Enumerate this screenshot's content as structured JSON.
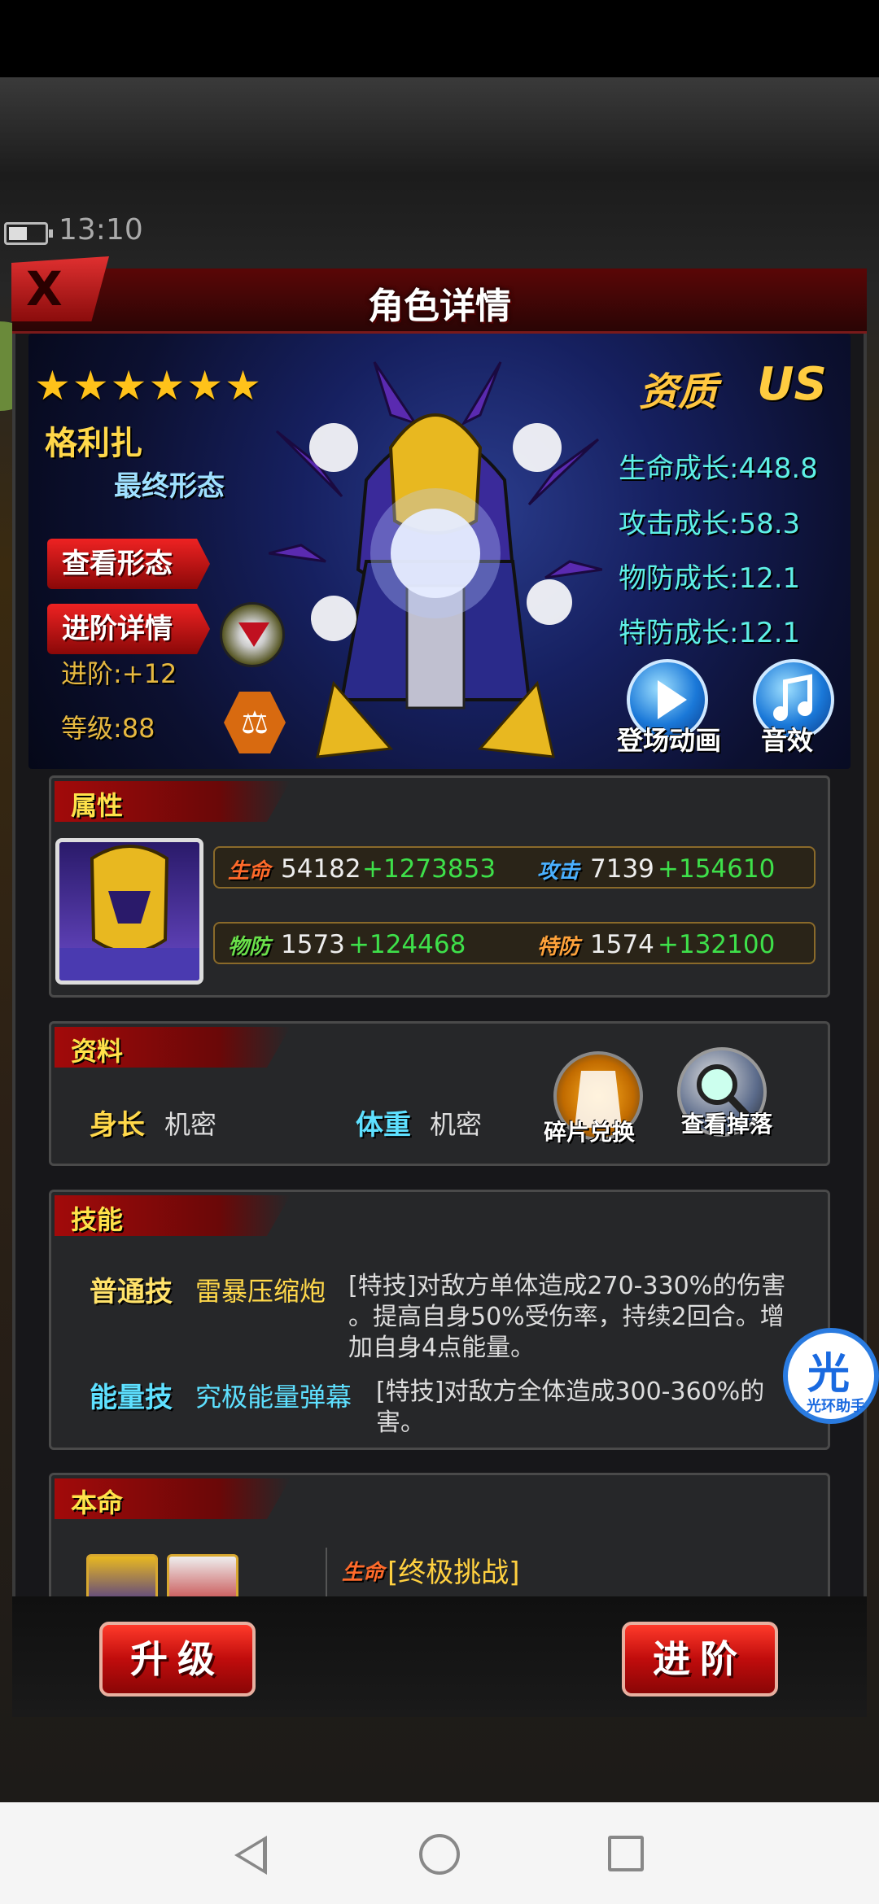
{
  "status": {
    "time": "13:10"
  },
  "dialog": {
    "title": "角色详情",
    "close_label": "X"
  },
  "hero": {
    "stars": "★★★★★★",
    "name": "格利扎",
    "form": "最终形态",
    "view_form_label": "查看形态",
    "advance_detail_label": "进阶详情",
    "advance": "进阶:+12",
    "level": "等级:88",
    "quality_label": "资质",
    "quality_value": "US",
    "growth": [
      "生命成长:448.8",
      "攻击成长:58.3",
      "物防成长:12.1",
      "特防成长:12.1"
    ],
    "entry_anim_label": "登场动画",
    "sound_label": "音效"
  },
  "attributes": {
    "section_title": "属性",
    "hp": {
      "icon": "生命",
      "value": "54182",
      "bonus": "+1273853"
    },
    "atk": {
      "icon": "攻击",
      "value": "7139",
      "bonus": "+154610"
    },
    "pdef": {
      "icon": "物防",
      "value": "1573",
      "bonus": "+124468"
    },
    "sdef": {
      "icon": "特防",
      "value": "1574",
      "bonus": "+132100"
    }
  },
  "profile": {
    "section_title": "资料",
    "height_label": "身长",
    "height_value": "机密",
    "weight_label": "体重",
    "weight_value": "机密",
    "shard_exchange_label": "碎片兑换",
    "view_drop_label": "查看掉落"
  },
  "skills": {
    "section_title": "技能",
    "normal": {
      "kind": "普通技",
      "name": "雷暴压缩炮",
      "desc_lines": [
        "[特技]对敌方单体造成270-330%的伤害",
        "。提高自身50%受伤率，持续2回合。增",
        "加自身4点能量。"
      ]
    },
    "energy": {
      "kind": "能量技",
      "name": "究极能量弹幕",
      "desc_lines": [
        "[特技]对敌方全体造成300-360%的",
        "害。"
      ]
    }
  },
  "fate": {
    "section_title": "本命",
    "icon": "生命",
    "title": "[终极挑战]"
  },
  "buttons": {
    "upgrade": "升级",
    "advance": "进阶"
  },
  "assistant": {
    "glyph": "光",
    "label": "光环助手"
  },
  "colors": {
    "accent_red": "#c00c0c",
    "gold": "#ffc640",
    "cyan": "#5ef0e6",
    "green": "#3ee04a"
  }
}
